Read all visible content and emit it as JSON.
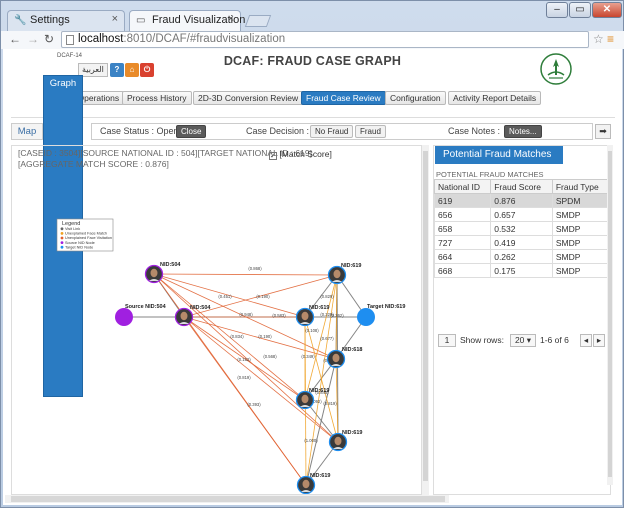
{
  "browser": {
    "tabs": [
      {
        "label": "Settings",
        "active": false
      },
      {
        "label": "Fraud Visualization |",
        "active": true
      }
    ],
    "url_host": "localhost",
    "url_path": ":8010/DCAF/#fraudvisualization"
  },
  "header": {
    "version": "DCAF-14",
    "lang_button": "العربية",
    "help_icon": "?",
    "title": "DCAF: FRAUD CASE GRAPH"
  },
  "menu": [
    {
      "label": "DCAF Operations",
      "active": false
    },
    {
      "label": "Process History",
      "active": false
    },
    {
      "label": "2D-3D Conversion Review",
      "active": false
    },
    {
      "label": "Fraud Case Review",
      "active": true
    },
    {
      "label": "Configuration",
      "active": false
    },
    {
      "label": "Activity Report Details",
      "active": false
    }
  ],
  "view_tabs": {
    "map": "Map",
    "graph": "Graph"
  },
  "status_bar": {
    "case_status_label": "Case Status : Open",
    "close_button": "Close",
    "case_decision_label": "Case Decision :",
    "no_fraud_button": "No Fraud",
    "fraud_button": "Fraud",
    "case_notes_label": "Case Notes :",
    "notes_button": "Notes...",
    "arrow_button": "➡"
  },
  "case_info": "[CASEID : 3504][SOURCE NATIONAL ID : 504][TARGET NATIONAL ID : 619][AGGREGATE MATCH SCORE : 0.876]",
  "match_score": {
    "label": "[Match Score]",
    "checked": true
  },
  "graph": {
    "legend": {
      "title": "Legend",
      "items": [
        {
          "label": "Visit Link",
          "color": "#666666"
        },
        {
          "label": "Unexplained Face Match",
          "color": "#f0a020"
        },
        {
          "label": "Unexplained Face Visitation",
          "color": "#e06030"
        },
        {
          "label": "Source NID Node",
          "color": "#a020e0"
        },
        {
          "label": "Target NID Node",
          "color": "#1e8ef0"
        }
      ]
    },
    "source_label": "Source NID:504",
    "target_label": "Target NID:619",
    "node_labels": {
      "a": "NID:504",
      "b": "NID:504",
      "c": "NID:619",
      "d": "NID:619",
      "e": "NID:618",
      "f": "NID:619",
      "g": "NID:619",
      "h": "NID:619"
    },
    "edge_labels": [
      "(0.868)",
      "(0.451)",
      "(0.190)",
      "(0.829)",
      "(0.948)",
      "(0.329)",
      "(0.583)",
      "(0.262)",
      "(0.834)",
      "(0.190)",
      "(0.108)",
      "(0.677)",
      "(0.349)",
      "(0.152)",
      "(0.568)",
      "(0.848)",
      "(0.819)",
      "(0.845)",
      "(0.092)",
      "(0.819)",
      "(1.000)",
      "(0.393)"
    ]
  },
  "matches": {
    "title": "Potential Fraud Matches",
    "subtitle": "POTENTIAL FRAUD MATCHES",
    "columns": [
      "National ID",
      "Fraud Score",
      "Fraud Type"
    ],
    "rows": [
      [
        "619",
        "0.876",
        "SPDM"
      ],
      [
        "656",
        "0.657",
        "SMDP"
      ],
      [
        "658",
        "0.532",
        "SMDP"
      ],
      [
        "727",
        "0.419",
        "SMDP"
      ],
      [
        "664",
        "0.262",
        "SMDP"
      ],
      [
        "668",
        "0.175",
        "SMDP"
      ]
    ],
    "selected_row": 0,
    "pager": {
      "page": "1",
      "show_rows_label": "Show rows:",
      "rows_value": "20",
      "range": "1-6 of 6"
    }
  }
}
